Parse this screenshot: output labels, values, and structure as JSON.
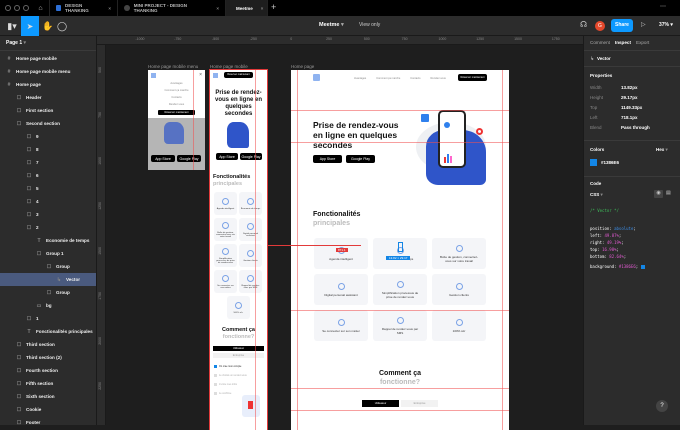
{
  "tabs": [
    {
      "label": "DESIGN THANKING",
      "active": false
    },
    {
      "label": "MINI PROJECT - DESIGN THANKING",
      "active": false
    },
    {
      "label": "Meetme",
      "active": true
    }
  ],
  "toolbar": {
    "file_name": "Meetme",
    "view_mode": "View only",
    "share_label": "Share",
    "zoom": "37%",
    "avatar_initial": "G"
  },
  "page_selector": "Page 1",
  "ruler_h": [
    "-1000",
    "-750",
    "-500",
    "-250",
    "0",
    "250",
    "500",
    "750",
    "1000",
    "1250",
    "1500",
    "1750"
  ],
  "ruler_v": [
    "500",
    "750",
    "1000",
    "1250",
    "1500",
    "1750",
    "2000",
    "2250"
  ],
  "layers": [
    {
      "label": "Home page mobile",
      "icon": "frame",
      "level": 0
    },
    {
      "label": "Home page mobile menu",
      "icon": "frame",
      "level": 0
    },
    {
      "label": "Home page",
      "icon": "frame",
      "level": 0
    },
    {
      "label": "Header",
      "icon": "group",
      "level": 1
    },
    {
      "label": "First section",
      "icon": "group",
      "level": 1
    },
    {
      "label": "Second section",
      "icon": "group",
      "level": 1
    },
    {
      "label": "9",
      "icon": "group",
      "level": 2
    },
    {
      "label": "8",
      "icon": "group",
      "level": 2
    },
    {
      "label": "7",
      "icon": "group",
      "level": 2
    },
    {
      "label": "6",
      "icon": "group",
      "level": 2
    },
    {
      "label": "5",
      "icon": "group",
      "level": 2
    },
    {
      "label": "4",
      "icon": "group",
      "level": 2
    },
    {
      "label": "3",
      "icon": "group",
      "level": 2
    },
    {
      "label": "2",
      "icon": "group",
      "level": 2
    },
    {
      "label": "Economie de temps",
      "icon": "text",
      "level": 3
    },
    {
      "label": "Group 1",
      "icon": "group",
      "level": 3
    },
    {
      "label": "Group",
      "icon": "group",
      "level": 4
    },
    {
      "label": "Vector",
      "icon": "vector",
      "level": 5,
      "selected": true
    },
    {
      "label": "Group",
      "icon": "group",
      "level": 4
    },
    {
      "label": "bg",
      "icon": "rect",
      "level": 3
    },
    {
      "label": "1",
      "icon": "group",
      "level": 2
    },
    {
      "label": "Fonctionalités principales",
      "icon": "text",
      "level": 2
    },
    {
      "label": "Third section",
      "icon": "group",
      "level": 1
    },
    {
      "label": "Third section (2)",
      "icon": "group",
      "level": 1
    },
    {
      "label": "Fourth section",
      "icon": "group",
      "level": 1
    },
    {
      "label": "Fifth section",
      "icon": "group",
      "level": 1
    },
    {
      "label": "Sixth section",
      "icon": "group",
      "level": 1
    },
    {
      "label": "Cookie",
      "icon": "group",
      "level": 1
    },
    {
      "label": "Footer",
      "icon": "group",
      "level": 1
    }
  ],
  "inspect": {
    "tabs": [
      "Comment",
      "Inspect",
      "Export"
    ],
    "selected_layer": "Vector",
    "properties_title": "Properties",
    "properties": [
      {
        "label": "Width",
        "value": "13.82px"
      },
      {
        "label": "Height",
        "value": "29.17px"
      },
      {
        "label": "Top",
        "value": "1149.33px"
      },
      {
        "label": "Left",
        "value": "718.1px"
      },
      {
        "label": "Blend",
        "value": "Pass through"
      }
    ],
    "colors_title": "Colors",
    "color_format": "Hex",
    "color_value": "#1386E6",
    "color_hex": "#1386E6",
    "code_title": "Code",
    "code_lang": "CSS",
    "code_comment": "/* Vector */",
    "code_lines": [
      {
        "prop": "position",
        "value": "absolute"
      },
      {
        "prop": "left",
        "value": "49.87%"
      },
      {
        "prop": "right",
        "value": "49.19%"
      },
      {
        "prop": "top",
        "value": "16.98%"
      },
      {
        "prop": "bottom",
        "value": "82.64%"
      }
    ],
    "code_bg_prop": "background",
    "code_bg_value": "#1386E6"
  },
  "canvas": {
    "frame_labels": [
      "Home page mobile menu",
      "Home page mobile",
      "Home page"
    ],
    "nav": [
      "Avantages",
      "Comment ça marche",
      "Contacts",
      "Rendez-vous",
      "Réserver maintenant"
    ],
    "hero_title": "Prise de rendez-vous en ligne en quelques secondes",
    "app_store": "App Store",
    "google_play": "Google Play",
    "features_title_1": "Fonctionalités",
    "features_title_2": "principales",
    "features": [
      "Agenda intelligent",
      "Économie de temps",
      "Boîte de gestion, connectez-vous sur votre travail",
      "Digital personal assistant",
      "Simplification processus de prise de rendez-vous",
      "Gestion clients",
      "Se connecter sur son métier",
      "Rappel de rendez-vous par SMS",
      "100% sûr"
    ],
    "distance_badge": "871.1",
    "size_badge": "13.82 × 29.17",
    "how_title_1": "Comment ça",
    "how_title_2": "fonctionne?",
    "how_tabs": [
      "Utilisateur",
      "Entreprise"
    ],
    "mobile_steps": [
      "On crée mon compte",
      "Je choisis un rendez-vous",
      "J'entre mes infos",
      "Je confirme"
    ],
    "help": "?"
  }
}
